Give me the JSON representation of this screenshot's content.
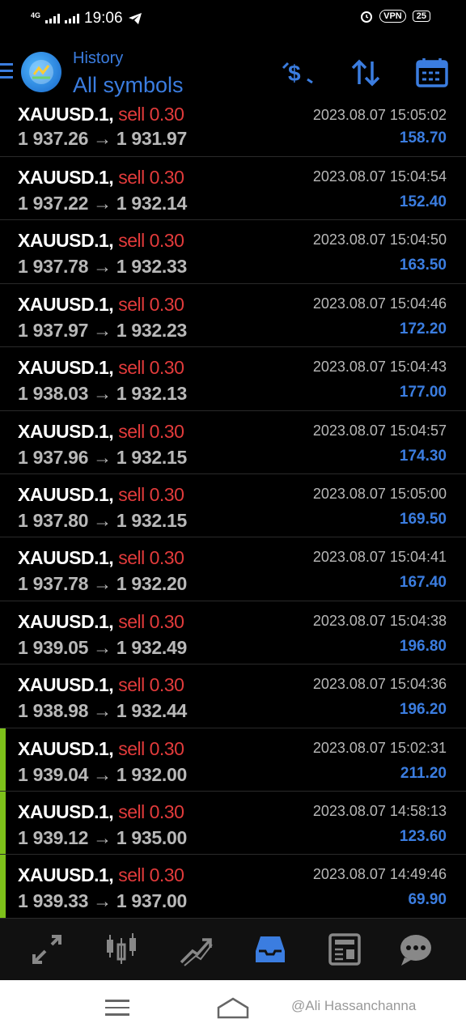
{
  "status_bar": {
    "network": "4G",
    "time": "19:06",
    "vpn": "VPN",
    "battery": "25"
  },
  "header": {
    "subtitle": "History",
    "title": "All symbols",
    "icons": [
      "menu-icon",
      "app-logo",
      "currency-icon",
      "sort-icon",
      "calendar-icon"
    ]
  },
  "accent_colors": {
    "blue": "#3b7de0",
    "sell_red": "#e23b3b",
    "marker_green": "#7dc11a"
  },
  "trades": [
    {
      "symbol": "XAUUSD.1,",
      "side": "sell 0.30",
      "open": "1 937.26",
      "arrow": "→",
      "close": "1 931.97",
      "time": "2023.08.07 15:05:02",
      "profit": "158.70",
      "marker": false
    },
    {
      "symbol": "XAUUSD.1,",
      "side": "sell 0.30",
      "open": "1 937.22",
      "arrow": "→",
      "close": "1 932.14",
      "time": "2023.08.07 15:04:54",
      "profit": "152.40",
      "marker": false
    },
    {
      "symbol": "XAUUSD.1,",
      "side": "sell 0.30",
      "open": "1 937.78",
      "arrow": "→",
      "close": "1 932.33",
      "time": "2023.08.07 15:04:50",
      "profit": "163.50",
      "marker": false
    },
    {
      "symbol": "XAUUSD.1,",
      "side": "sell 0.30",
      "open": "1 937.97",
      "arrow": "→",
      "close": "1 932.23",
      "time": "2023.08.07 15:04:46",
      "profit": "172.20",
      "marker": false
    },
    {
      "symbol": "XAUUSD.1,",
      "side": "sell 0.30",
      "open": "1 938.03",
      "arrow": "→",
      "close": "1 932.13",
      "time": "2023.08.07 15:04:43",
      "profit": "177.00",
      "marker": false
    },
    {
      "symbol": "XAUUSD.1,",
      "side": "sell 0.30",
      "open": "1 937.96",
      "arrow": "→",
      "close": "1 932.15",
      "time": "2023.08.07 15:04:57",
      "profit": "174.30",
      "marker": false
    },
    {
      "symbol": "XAUUSD.1,",
      "side": "sell 0.30",
      "open": "1 937.80",
      "arrow": "→",
      "close": "1 932.15",
      "time": "2023.08.07 15:05:00",
      "profit": "169.50",
      "marker": false
    },
    {
      "symbol": "XAUUSD.1,",
      "side": "sell 0.30",
      "open": "1 937.78",
      "arrow": "→",
      "close": "1 932.20",
      "time": "2023.08.07 15:04:41",
      "profit": "167.40",
      "marker": false
    },
    {
      "symbol": "XAUUSD.1,",
      "side": "sell 0.30",
      "open": "1 939.05",
      "arrow": "→",
      "close": "1 932.49",
      "time": "2023.08.07 15:04:38",
      "profit": "196.80",
      "marker": false
    },
    {
      "symbol": "XAUUSD.1,",
      "side": "sell 0.30",
      "open": "1 938.98",
      "arrow": "→",
      "close": "1 932.44",
      "time": "2023.08.07 15:04:36",
      "profit": "196.20",
      "marker": false
    },
    {
      "symbol": "XAUUSD.1,",
      "side": "sell 0.30",
      "open": "1 939.04",
      "arrow": "→",
      "close": "1 932.00",
      "time": "2023.08.07 15:02:31",
      "profit": "211.20",
      "marker": true
    },
    {
      "symbol": "XAUUSD.1,",
      "side": "sell 0.30",
      "open": "1 939.12",
      "arrow": "→",
      "close": "1 935.00",
      "time": "2023.08.07 14:58:13",
      "profit": "123.60",
      "marker": true
    },
    {
      "symbol": "XAUUSD.1,",
      "side": "sell 0.30",
      "open": "1 939.33",
      "arrow": "→",
      "close": "1 937.00",
      "time": "2023.08.07 14:49:46",
      "profit": "69.90",
      "marker": true
    }
  ],
  "tabs": [
    {
      "icon": "quotes-icon"
    },
    {
      "icon": "chart-icon"
    },
    {
      "icon": "trade-icon"
    },
    {
      "icon": "history-icon",
      "active": true
    },
    {
      "icon": "news-icon"
    },
    {
      "icon": "chat-icon"
    }
  ],
  "system_nav": {
    "watermark": "@Ali Hassanchanna"
  }
}
